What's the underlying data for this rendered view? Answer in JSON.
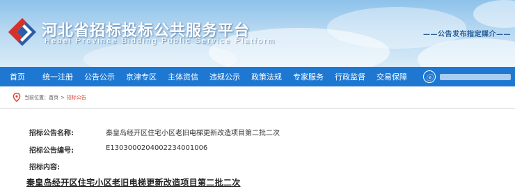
{
  "header": {
    "title": "河北省招标投标公共服务平台",
    "subtitle": "Hebei Province Bidding Public Service Platform",
    "slogan": "——公告发布指定媒介——"
  },
  "nav": {
    "items": [
      "首页",
      "统一注册",
      "公告公示",
      "京津专区",
      "主体资信",
      "违规公示",
      "政策法规",
      "专家服务",
      "行政监督",
      "交易保障"
    ]
  },
  "breadcrumb": {
    "prefix": "当前位置：",
    "home": "首页",
    "separator": ">",
    "current": "招标公告"
  },
  "notice": {
    "name_label": "招标公告名称:",
    "name_value": "秦皇岛经开区住宅小区老旧电梯更新改造项目第二批二次",
    "number_label": "招标公告编号:",
    "number_value": "E1303000204002234001006",
    "content_label": "招标内容:",
    "content_title": "秦皇岛经开区住宅小区老旧电梯更新改造项目第二批二次"
  },
  "colors": {
    "nav_bg": "#1e78d2",
    "breadcrumb_current": "#e2402b",
    "logo_red": "#d8312a",
    "logo_blue": "#2a5ea8"
  },
  "icons": {
    "logo": "diamond-logo-icon",
    "location": "location-pin-icon",
    "weibo": "weibo-icon"
  }
}
